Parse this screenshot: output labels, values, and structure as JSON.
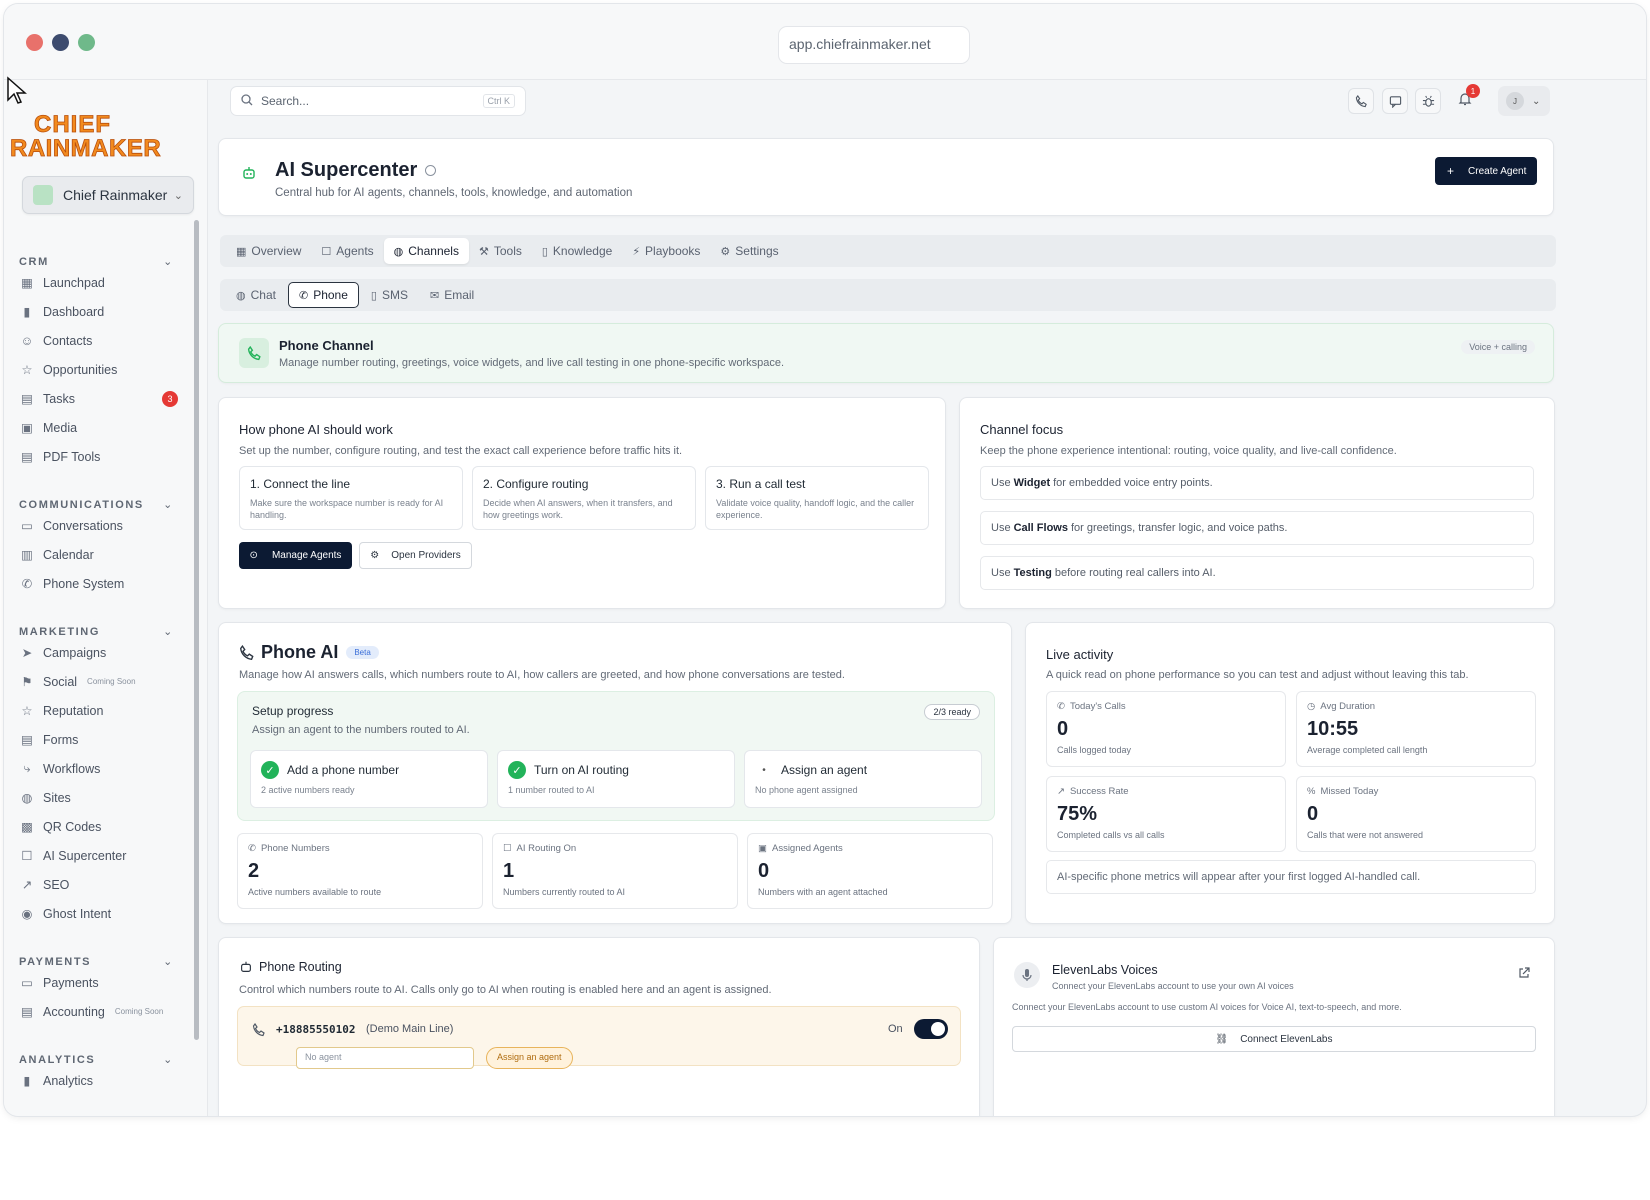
{
  "browser": {
    "url": "app.chiefrainmaker.net"
  },
  "brand": {
    "logo_line1": "CHIEF",
    "logo_line2": "RAINMAKER",
    "org_name": "Chief Rainmaker"
  },
  "sidebar": {
    "sections": [
      {
        "title": "CRM",
        "items": [
          {
            "label": "Launchpad",
            "icon": "grid-icon"
          },
          {
            "label": "Dashboard",
            "icon": "bar-chart-icon"
          },
          {
            "label": "Contacts",
            "icon": "users-icon"
          },
          {
            "label": "Opportunities",
            "icon": "star-icon"
          },
          {
            "label": "Tasks",
            "icon": "document-icon",
            "badge": "3"
          },
          {
            "label": "Media",
            "icon": "image-icon"
          },
          {
            "label": "PDF Tools",
            "icon": "document-icon"
          }
        ]
      },
      {
        "title": "COMMUNICATIONS",
        "items": [
          {
            "label": "Conversations",
            "icon": "chat-icon"
          },
          {
            "label": "Calendar",
            "icon": "calendar-icon"
          },
          {
            "label": "Phone System",
            "icon": "phone-icon"
          }
        ]
      },
      {
        "title": "MARKETING",
        "items": [
          {
            "label": "Campaigns",
            "icon": "send-icon"
          },
          {
            "label": "Social",
            "icon": "social-icon",
            "note": "Coming Soon"
          },
          {
            "label": "Reputation",
            "icon": "star-icon"
          },
          {
            "label": "Forms",
            "icon": "document-icon"
          },
          {
            "label": "Workflows",
            "icon": "workflow-icon"
          },
          {
            "label": "Sites",
            "icon": "globe-icon"
          },
          {
            "label": "QR Codes",
            "icon": "qr-icon"
          },
          {
            "label": "AI Supercenter",
            "icon": "robot-icon"
          },
          {
            "label": "SEO",
            "icon": "trend-icon"
          },
          {
            "label": "Ghost Intent",
            "icon": "eye-icon"
          }
        ]
      },
      {
        "title": "PAYMENTS",
        "items": [
          {
            "label": "Payments",
            "icon": "card-icon"
          },
          {
            "label": "Accounting",
            "icon": "ledger-icon",
            "note": "Coming Soon"
          }
        ]
      },
      {
        "title": "ANALYTICS",
        "items": [
          {
            "label": "Analytics",
            "icon": "bar-chart-icon"
          }
        ]
      }
    ]
  },
  "topbar": {
    "search_placeholder": "Search...",
    "shortcut": "Ctrl K",
    "notif_count": "1",
    "avatar_initial": "J"
  },
  "header": {
    "title": "AI Supercenter",
    "subtitle": "Central hub for AI agents, channels, tools, knowledge, and automation",
    "create_button": "Create Agent"
  },
  "tabs": [
    {
      "label": "Overview",
      "icon": "grid-icon"
    },
    {
      "label": "Agents",
      "icon": "robot-icon"
    },
    {
      "label": "Channels",
      "icon": "globe-icon",
      "active": true
    },
    {
      "label": "Tools",
      "icon": "wrench-icon"
    },
    {
      "label": "Knowledge",
      "icon": "book-icon"
    },
    {
      "label": "Playbooks",
      "icon": "bolt-icon"
    },
    {
      "label": "Settings",
      "icon": "gear-icon"
    }
  ],
  "subtabs": [
    {
      "label": "Chat",
      "icon": "globe-icon"
    },
    {
      "label": "Phone",
      "icon": "phone-icon",
      "active": true
    },
    {
      "label": "SMS",
      "icon": "mobile-icon"
    },
    {
      "label": "Email",
      "icon": "mail-icon"
    }
  ],
  "phone_channel": {
    "title": "Phone Channel",
    "desc": "Manage number routing, greetings, voice widgets, and live call testing in one phone-specific workspace.",
    "tag": "Voice + calling"
  },
  "how_it_works": {
    "title": "How phone AI should work",
    "desc": "Set up the number, configure routing, and test the exact call experience before traffic hits it.",
    "steps": [
      {
        "title": "1. Connect the line",
        "desc": "Make sure the workspace number is ready for AI handling."
      },
      {
        "title": "2. Configure routing",
        "desc": "Decide when AI answers, when it transfers, and how greetings work."
      },
      {
        "title": "3. Run a call test",
        "desc": "Validate voice quality, handoff logic, and the caller experience."
      }
    ],
    "manage_button": "Manage Agents",
    "providers_button": "Open Providers"
  },
  "channel_focus": {
    "title": "Channel focus",
    "desc": "Keep the phone experience intentional: routing, voice quality, and live-call confidence.",
    "items": [
      {
        "pre": "Use",
        "bold": "Widget",
        "post": "for embedded voice entry points."
      },
      {
        "pre": "Use",
        "bold": "Call Flows",
        "post": "for greetings, transfer logic, and voice paths."
      },
      {
        "pre": "Use",
        "bold": "Testing",
        "post": "before routing real callers into AI."
      }
    ]
  },
  "phone_ai": {
    "title": "Phone AI",
    "beta": "Beta",
    "desc": "Manage how AI answers calls, which numbers route to AI, how callers are greeted, and how phone conversations are tested.",
    "setup": {
      "title": "Setup progress",
      "desc": "Assign an agent to the numbers routed to AI.",
      "ready": "2/3 ready",
      "steps": [
        {
          "title": "Add a phone number",
          "desc": "2 active numbers ready",
          "done": true
        },
        {
          "title": "Turn on AI routing",
          "desc": "1 number routed to AI",
          "done": true
        },
        {
          "title": "Assign an agent",
          "desc": "No phone agent assigned",
          "done": false
        }
      ]
    },
    "stats": [
      {
        "label": "Phone Numbers",
        "value": "2",
        "desc": "Active numbers available to route",
        "icon": "phone-icon"
      },
      {
        "label": "AI Routing On",
        "value": "1",
        "desc": "Numbers currently routed to AI",
        "icon": "robot-icon"
      },
      {
        "label": "Assigned Agents",
        "value": "0",
        "desc": "Numbers with an agent attached",
        "icon": "agent-icon"
      }
    ]
  },
  "live_activity": {
    "title": "Live activity",
    "desc": "A quick read on phone performance so you can test and adjust without leaving this tab.",
    "stats": [
      {
        "label": "Today's Calls",
        "value": "0",
        "desc": "Calls logged today",
        "icon": "phone-icon"
      },
      {
        "label": "Avg Duration",
        "value": "10:55",
        "desc": "Average completed call length",
        "icon": "clock-icon"
      },
      {
        "label": "Success Rate",
        "value": "75%",
        "desc": "Completed calls vs all calls",
        "icon": "trend-icon"
      },
      {
        "label": "Missed Today",
        "value": "0",
        "desc": "Calls that were not answered",
        "icon": "percent-icon"
      }
    ],
    "note": "AI-specific phone metrics will appear after your first logged AI-handled call."
  },
  "routing": {
    "title": "Phone Routing",
    "desc": "Control which numbers route to AI. Calls only go to AI when routing is enabled here and an agent is assigned.",
    "number": "+18885550102",
    "number_label": "(Demo Main Line)",
    "toggle_label": "On",
    "agent_placeholder": "No agent",
    "assign_label": "Assign an agent"
  },
  "elevenlabs": {
    "title": "ElevenLabs Voices",
    "desc": "Connect your ElevenLabs account to use your own AI voices",
    "desc2": "Connect your ElevenLabs account to use custom AI voices for Voice AI, text-to-speech, and more.",
    "button": "Connect ElevenLabs"
  },
  "colors": {
    "accent": "#0c1a33",
    "success": "#22b35a",
    "danger": "#e53935",
    "logo_orange": "#f28a1e"
  }
}
